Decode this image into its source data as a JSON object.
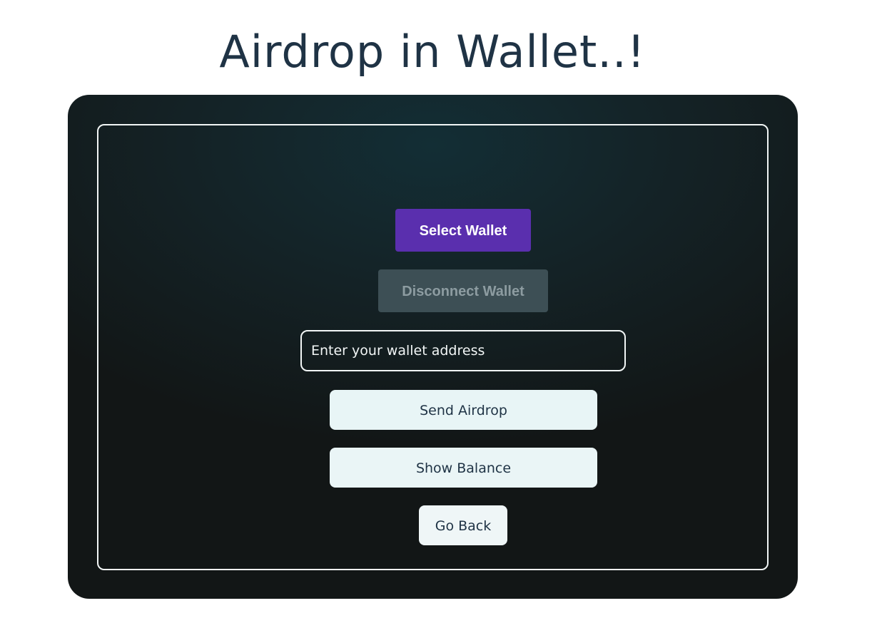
{
  "page": {
    "title": "Airdrop in Wallet..!"
  },
  "wallet": {
    "select_label": "Select Wallet",
    "disconnect_label": "Disconnect Wallet"
  },
  "form": {
    "address_placeholder": "Enter your wallet address",
    "address_value": ""
  },
  "actions": {
    "send_airdrop_label": "Send Airdrop",
    "show_balance_label": "Show Balance",
    "go_back_label": "Go Back"
  },
  "colors": {
    "title": "#1f3345",
    "card_background": "#121616",
    "card_glow": "#132e35",
    "select_wallet_button": "#5a2fae",
    "disconnect_button": "#3d4f55",
    "light_button": "#e8f5f6",
    "frame_border": "#f2f6f6"
  }
}
